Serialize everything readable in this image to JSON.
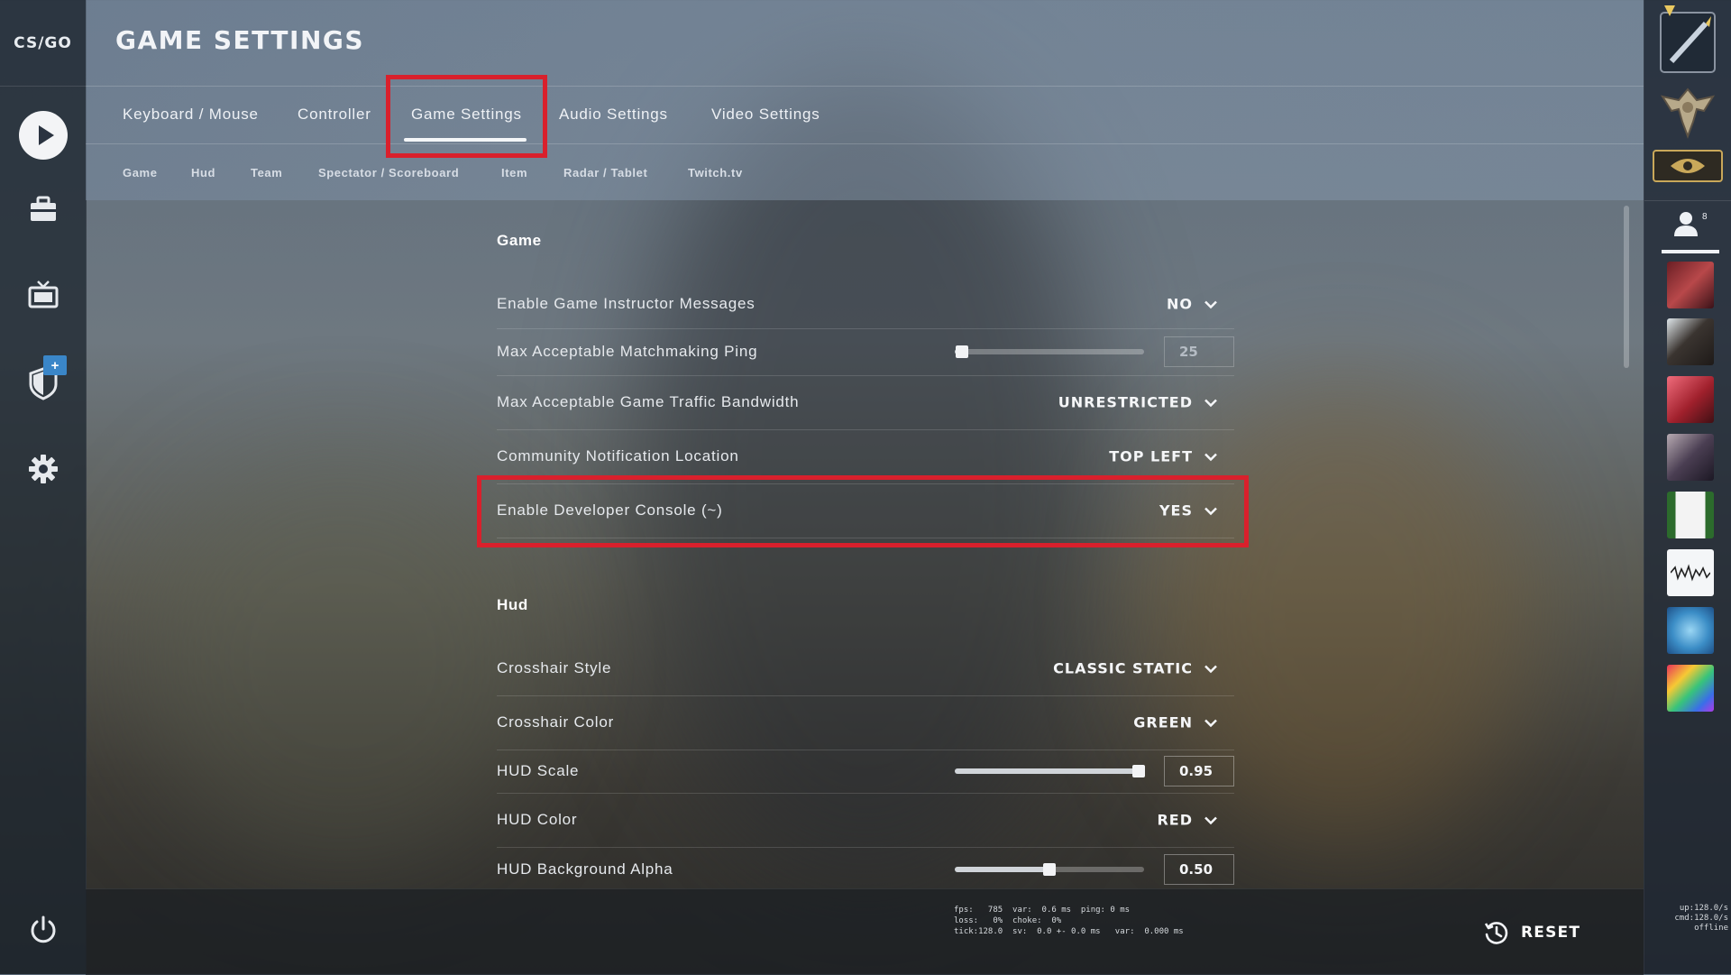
{
  "app": {
    "logo_text": "CS/GO"
  },
  "page_title": "GAME SETTINGS",
  "tabs": [
    {
      "label": "Keyboard / Mouse"
    },
    {
      "label": "Controller"
    },
    {
      "label": "Game Settings",
      "active": true
    },
    {
      "label": "Audio Settings"
    },
    {
      "label": "Video Settings"
    }
  ],
  "subtabs": [
    {
      "label": "Game"
    },
    {
      "label": "Hud"
    },
    {
      "label": "Team"
    },
    {
      "label": "Spectator / Scoreboard"
    },
    {
      "label": "Item"
    },
    {
      "label": "Radar / Tablet"
    },
    {
      "label": "Twitch.tv"
    }
  ],
  "sections": {
    "game": {
      "title": "Game",
      "rows": [
        {
          "label": "Enable Game Instructor Messages",
          "type": "dropdown",
          "value": "NO"
        },
        {
          "label": "Max Acceptable Matchmaking Ping",
          "type": "slider",
          "value": "25",
          "fraction": 0.04
        },
        {
          "label": "Max Acceptable Game Traffic Bandwidth",
          "type": "dropdown",
          "value": "UNRESTRICTED"
        },
        {
          "label": "Community Notification Location",
          "type": "dropdown",
          "value": "TOP LEFT"
        },
        {
          "label": "Enable Developer Console (~)",
          "type": "dropdown",
          "value": "YES"
        }
      ]
    },
    "hud": {
      "title": "Hud",
      "rows": [
        {
          "label": "Crosshair Style",
          "type": "dropdown",
          "value": "CLASSIC STATIC"
        },
        {
          "label": "Crosshair Color",
          "type": "dropdown",
          "value": "GREEN"
        },
        {
          "label": "HUD Scale",
          "type": "slider",
          "value": "0.95",
          "fraction": 0.97
        },
        {
          "label": "HUD Color",
          "type": "dropdown",
          "value": "RED"
        },
        {
          "label": "HUD Background Alpha",
          "type": "slider",
          "value": "0.50",
          "fraction": 0.5
        }
      ]
    }
  },
  "footer": {
    "netgraph": "fps:   785  var:  0.6 ms  ping: 0 ms\nloss:   0%  choke:  0%\ntick:128.0  sv:  0.0 +- 0.0 ms   var:  0.000 ms",
    "reset_label": "RESET"
  },
  "right_sidebar": {
    "friends_count": "8",
    "stats": "up:128.0/s\ncmd:128.0/s\noffline"
  },
  "colors": {
    "highlight": "#d9202c",
    "bg_sidebar": "#1e2630"
  }
}
